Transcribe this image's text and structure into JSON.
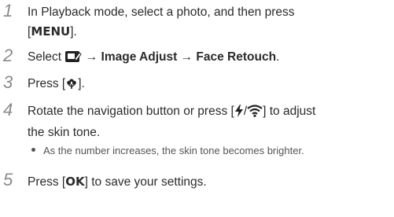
{
  "steps": [
    {
      "number": "1",
      "line1": "In Playback mode, select a photo, and then press",
      "open": "[",
      "key": "MENU",
      "close": "]."
    },
    {
      "number": "2",
      "prefix": "Select",
      "arrow1": "→",
      "item1": "Image Adjust",
      "arrow2": "→",
      "item2": "Face Retouch",
      "suffix": "."
    },
    {
      "number": "3",
      "prefix": "Press [",
      "suffix": "]."
    },
    {
      "number": "4",
      "prefix": "Rotate the navigation button or press [",
      "slash": "/",
      "suffix": "] to adjust",
      "line2": "the skin tone.",
      "bullet": "As the number increases, the skin tone becomes brighter."
    },
    {
      "number": "5",
      "prefix": "Press [",
      "key": "OK",
      "suffix": "] to save your settings."
    }
  ],
  "icons": {
    "edit": "photo-edit-icon",
    "macro": "macro-flower-icon",
    "flash": "flash-icon",
    "wifi": "wifi-icon"
  }
}
